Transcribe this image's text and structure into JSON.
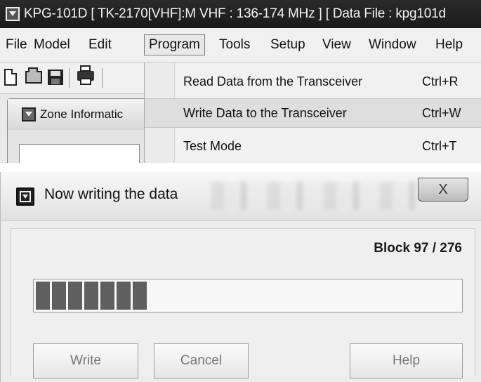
{
  "app": {
    "title": "KPG-101D  [ TK-2170[VHF]:M VHF : 136-174 MHz ] [ Data File : kpg101d"
  },
  "menubar": {
    "items": [
      {
        "label": "File"
      },
      {
        "label": "Model"
      },
      {
        "label": "Edit"
      },
      {
        "label": "Program"
      },
      {
        "label": "Tools"
      },
      {
        "label": "Setup"
      },
      {
        "label": "View"
      },
      {
        "label": "Window"
      },
      {
        "label": "Help"
      }
    ],
    "active": "Program"
  },
  "toolbar": {
    "buttons": [
      "new-file-icon",
      "open-folder-icon",
      "save-icon",
      "print-icon"
    ]
  },
  "zone_panel": {
    "tab_label": "Zone Informatic"
  },
  "program_menu": {
    "items": [
      {
        "label": "Read Data from the Transceiver",
        "shortcut": "Ctrl+R"
      },
      {
        "label": "Write Data to the Transceiver",
        "shortcut": "Ctrl+W",
        "highlighted": true
      },
      {
        "label": "Test Mode",
        "shortcut": "Ctrl+T"
      }
    ]
  },
  "dialog": {
    "title": "Now writing the data",
    "close_label": "X",
    "status": "Block 97 / 276",
    "progress": {
      "current": 97,
      "total": 276,
      "segments_filled": 7
    },
    "buttons": {
      "write": "Write",
      "cancel": "Cancel",
      "help": "Help"
    }
  }
}
